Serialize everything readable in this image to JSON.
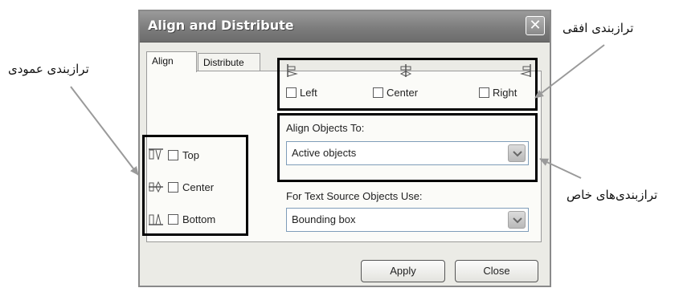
{
  "dialog": {
    "title": "Align and Distribute",
    "tabs": [
      {
        "label": "Align"
      },
      {
        "label": "Distribute"
      }
    ],
    "horizontal": {
      "options": [
        {
          "label": "Left",
          "icon": "align-left-icon",
          "checked": false
        },
        {
          "label": "Center",
          "icon": "align-center-horizontal-icon",
          "checked": false
        },
        {
          "label": "Right",
          "icon": "align-right-icon",
          "checked": false
        }
      ]
    },
    "vertical": {
      "options": [
        {
          "label": "Top",
          "icon": "align-top-icon",
          "checked": false
        },
        {
          "label": "Center",
          "icon": "align-center-vertical-icon",
          "checked": false
        },
        {
          "label": "Bottom",
          "icon": "align-bottom-icon",
          "checked": false
        }
      ]
    },
    "align_to": {
      "label": "Align Objects To:",
      "value": "Active objects"
    },
    "text_source": {
      "label": "For Text Source Objects Use:",
      "value": "Bounding box"
    },
    "buttons": {
      "apply": "Apply",
      "close": "Close"
    }
  },
  "annotations": {
    "horizontal": "ترازبندی افقی",
    "vertical": "ترازبندی عمودی",
    "special": "ترازبندی‌های خاص"
  },
  "colors": {
    "title_bar": "#7d7d7d",
    "panel": "#fbfbf8",
    "frame": "#ebebe6",
    "callout_box": "#000000"
  }
}
